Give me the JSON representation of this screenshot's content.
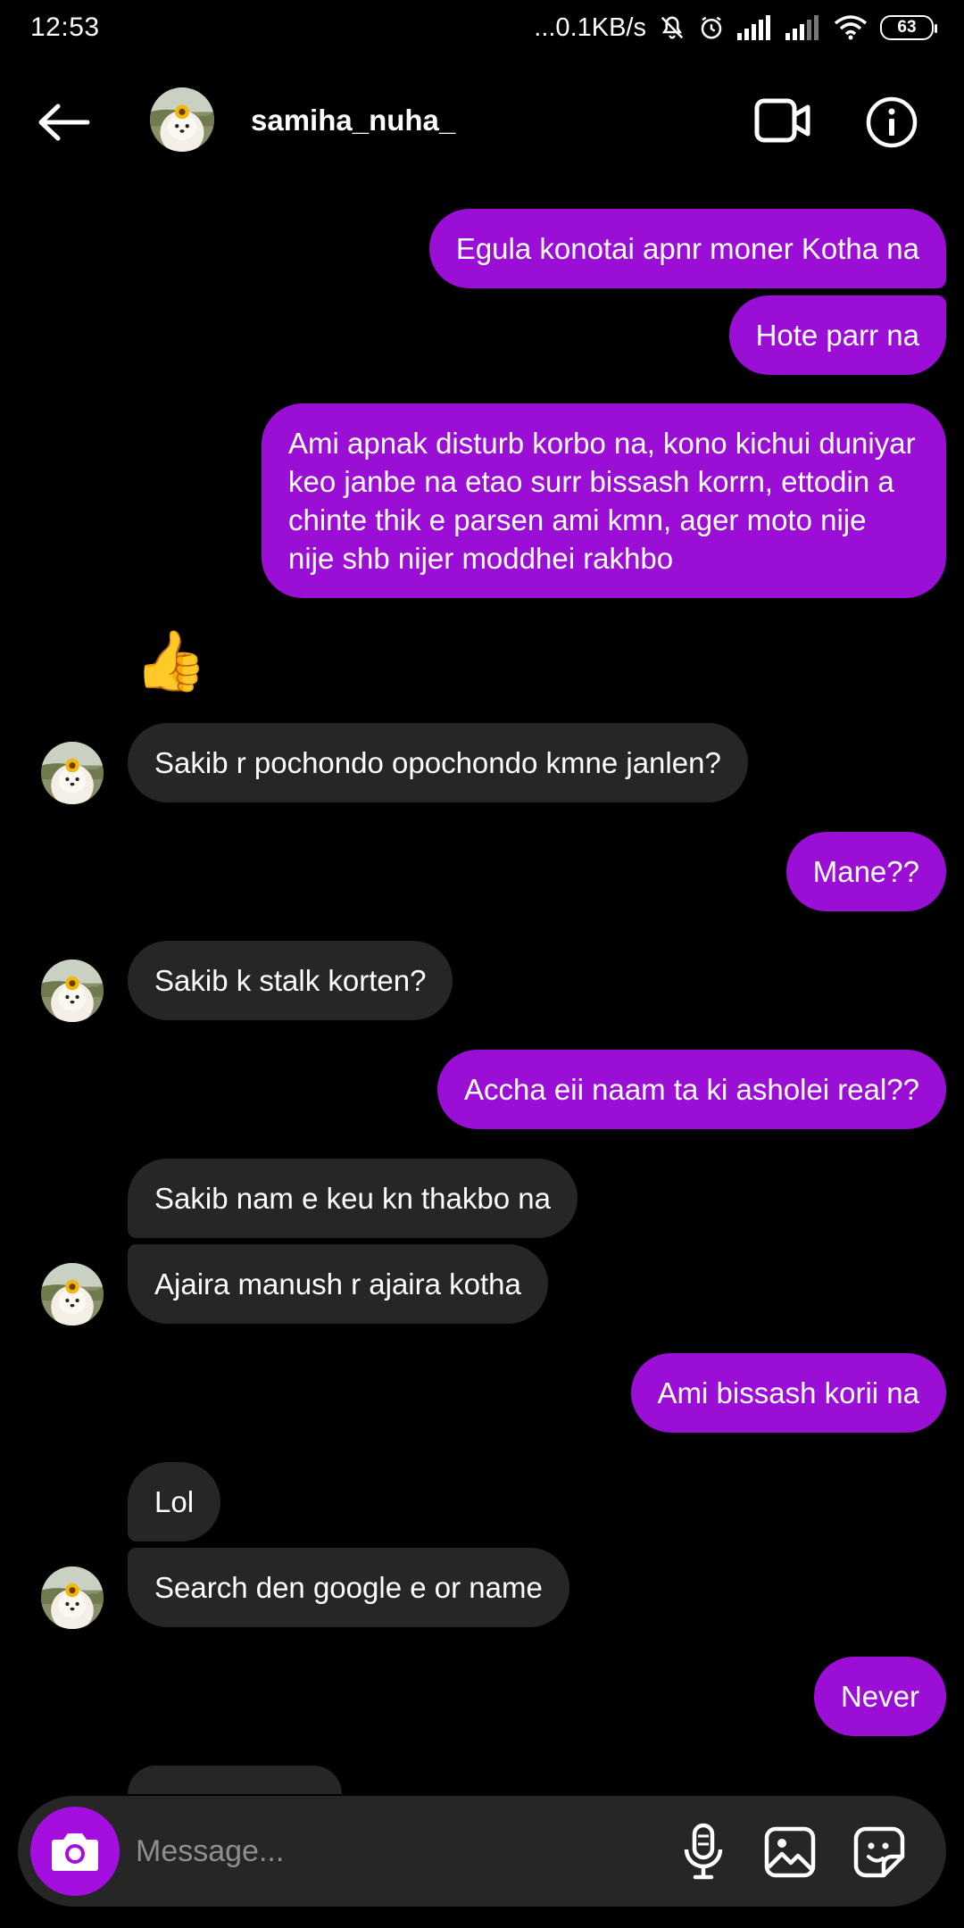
{
  "status_bar": {
    "time": "12:53",
    "network_speed": "...0.1KB/s",
    "battery": "63",
    "icons": [
      "mute-icon",
      "alarm-icon",
      "signal-icon",
      "signal-icon",
      "wifi-icon",
      "battery-icon"
    ]
  },
  "header": {
    "username": "samiha_nuha_",
    "icons": [
      "back-arrow-icon",
      "video-call-icon",
      "info-icon"
    ]
  },
  "messages": [
    {
      "side": "sent",
      "text": "Egula konotai apnr moner Kotha na"
    },
    {
      "side": "sent",
      "text": "Hote parr na"
    },
    {
      "side": "sent",
      "text": "Ami apnak disturb korbo na, kono kichui duniyar keo janbe na etao surr bissash korrn, ettodin a chinte thik e parsen ami kmn, ager moto nije nije shb nijer moddhei rakhbo"
    },
    {
      "side": "received",
      "text": "👍"
    },
    {
      "side": "received",
      "text": "Sakib r pochondo opochondo kmne janlen?"
    },
    {
      "side": "sent",
      "text": "Mane??"
    },
    {
      "side": "received",
      "text": "Sakib k stalk korten?"
    },
    {
      "side": "sent",
      "text": "Accha eii naam ta ki asholei real??"
    },
    {
      "side": "received",
      "text": "Sakib nam e keu kn thakbo na"
    },
    {
      "side": "received",
      "text": "Ajaira manush r ajaira kotha"
    },
    {
      "side": "sent",
      "text": "Ami bissash korii na"
    },
    {
      "side": "received",
      "text": "Lol"
    },
    {
      "side": "received",
      "text": "Search den google e or name"
    },
    {
      "side": "sent",
      "text": "Never"
    }
  ],
  "composer": {
    "placeholder": "Message...",
    "icons": [
      "camera-icon",
      "microphone-icon",
      "gallery-icon",
      "sticker-icon"
    ]
  },
  "colors": {
    "sent_bubble": "#9b0ed6",
    "received_bubble": "#262626",
    "background": "#000000",
    "camera_button": "#a40fe0"
  }
}
